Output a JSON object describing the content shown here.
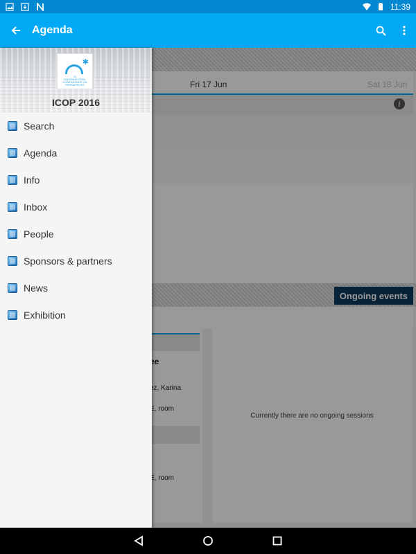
{
  "status_bar": {
    "time": "11:39",
    "left_icons": [
      "image-icon",
      "download-icon",
      "n-icon"
    ],
    "right_icons": [
      "wifi-icon",
      "battery-icon"
    ]
  },
  "app_bar": {
    "title": "Agenda",
    "back_icon": "arrow-left-icon",
    "search_icon": "search-icon",
    "overflow_icon": "more-vert-icon",
    "color": "#03a9f4"
  },
  "drawer": {
    "header_title": "ICOP 2016",
    "logo_text": "XI INTERNATIONAL CONFERENCE ON PERMAFROST",
    "items": [
      {
        "label": "Search",
        "icon": "search-icon"
      },
      {
        "label": "Agenda",
        "icon": "agenda-icon"
      },
      {
        "label": "Info",
        "icon": "info-icon"
      },
      {
        "label": "Inbox",
        "icon": "inbox-icon"
      },
      {
        "label": "People",
        "icon": "people-icon"
      },
      {
        "label": "Sponsors & partners",
        "icon": "sponsors-icon"
      },
      {
        "label": "News",
        "icon": "news-icon"
      },
      {
        "label": "Exhibition",
        "icon": "exhibition-icon"
      }
    ]
  },
  "content": {
    "days": [
      {
        "label": "Fri 17 Jun",
        "selected": true
      },
      {
        "label": "Sat 18 Jun",
        "selected": false
      }
    ],
    "ongoing_label": "Ongoing events",
    "no_sessions": "Currently there are no ongoing sessions",
    "partial_texts": [
      "ee",
      "ez, Karina",
      "E, room",
      "E, room"
    ]
  },
  "nav_bar": {
    "icons": [
      "back-triangle-icon",
      "home-circle-icon",
      "recents-square-icon"
    ]
  }
}
